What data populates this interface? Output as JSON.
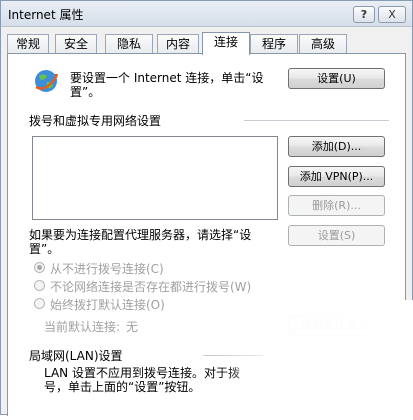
{
  "window": {
    "title": "Internet 属性",
    "help_label": "?",
    "close_label": "X"
  },
  "tabs": [
    {
      "label": "常规"
    },
    {
      "label": "安全"
    },
    {
      "label": "隐私"
    },
    {
      "label": "内容"
    },
    {
      "label": "连接"
    },
    {
      "label": "程序"
    },
    {
      "label": "高级"
    }
  ],
  "active_tab": "连接",
  "setup": {
    "text_line1": "要设置一个 Internet 连接，单击“设",
    "text_line2": "置”。",
    "button": "设置(U)",
    "icon": "globe-network-icon"
  },
  "dialup": {
    "heading": "拨号和虚拟专用网络设置",
    "add_button": "添加(D)...",
    "add_vpn_button": "添加 VPN(P)...",
    "remove_button": "删除(R)...",
    "proxy_text_line1": "如果要为连接配置代理服务器，请选择“设",
    "proxy_text_line2": "置”。",
    "settings_button": "设置(S)",
    "options": [
      {
        "label": "从不进行拨号连接(C)",
        "checked": true
      },
      {
        "label": "不论网络连接是否存在都进行拨号(W)",
        "checked": false
      },
      {
        "label": "始终拨打默认连接(O)",
        "checked": false
      }
    ],
    "current_default_label": "当前默认连接:",
    "current_default_value": "无",
    "set_default_button": "设置默认值(E)"
  },
  "lan": {
    "heading": "局域网(LAN)设置",
    "text_line1": "LAN 设置不应用到拨号连接。对于拨",
    "text_line2": "号，单击上面的“设置”按钮。"
  }
}
